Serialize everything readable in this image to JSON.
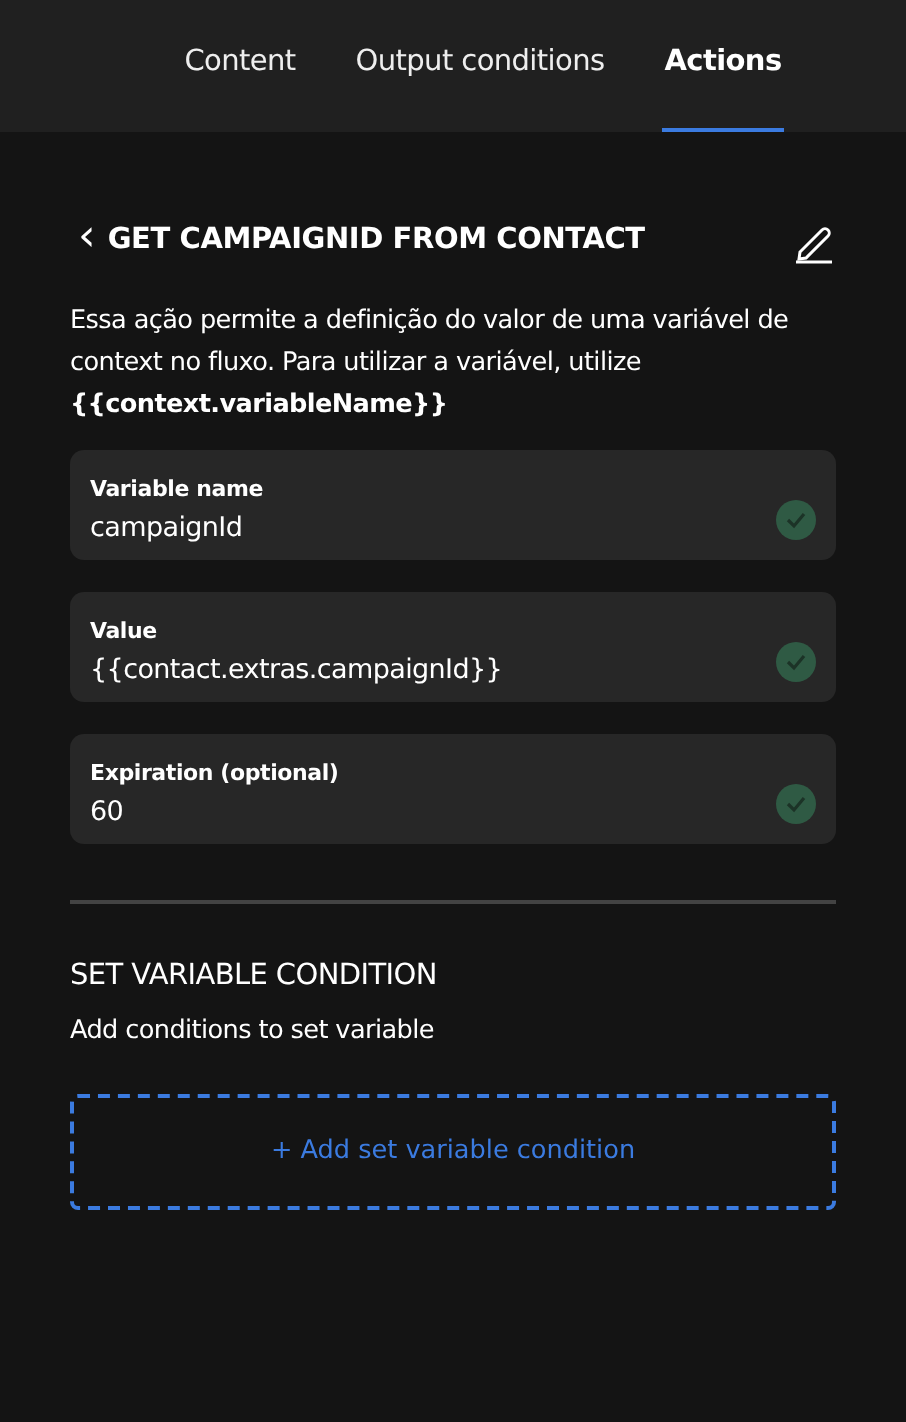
{
  "tabs": [
    {
      "label": "Content",
      "selected": false
    },
    {
      "label": "Output conditions",
      "selected": false
    },
    {
      "label": "Actions",
      "selected": true
    }
  ],
  "action": {
    "back_icon": "‹",
    "title": "GET CAMPAIGNID FROM CONTACT",
    "description": "Essa ação permite a definição do valor de uma variável de context no fluxo. Para utilizar a variável, utilize **{{context.variableName}}**"
  },
  "fields": [
    {
      "label": "Variable name",
      "value": "campaignId",
      "valid": true
    },
    {
      "label": "Value",
      "value": "{{contact.extras.campaignId}}",
      "valid": true
    },
    {
      "label": "Expiration (optional)",
      "value": "60",
      "valid": true
    }
  ],
  "condition_section": {
    "title": "SET VARIABLE CONDITION",
    "subtitle": "Add conditions to set variable",
    "add_button": "+ Add set variable condition"
  }
}
